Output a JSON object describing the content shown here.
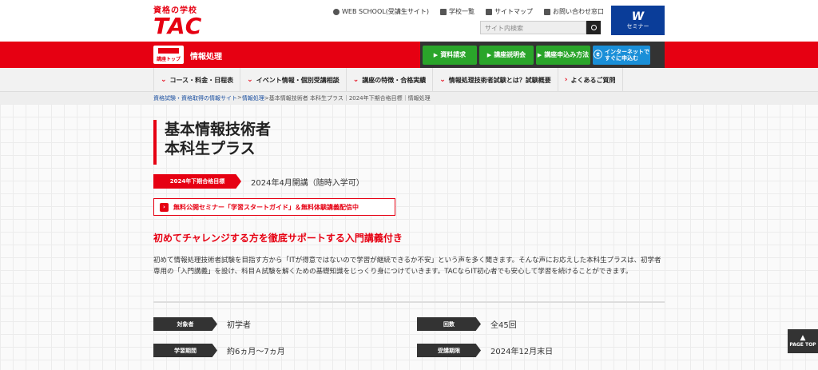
{
  "header": {
    "logo_top": "資格の学校",
    "logo_main": "TAC",
    "util_links": [
      "WEB SCHOOL(受講生サイト)",
      "学校一覧",
      "サイトマップ",
      "お問い合わせ窓口"
    ],
    "search_placeholder": "サイト内検索",
    "waseda_logo": "W",
    "waseda_text": "セミナー"
  },
  "redbar": {
    "course_top_label": "講座トップ",
    "title": "情報処理",
    "cta": [
      "資料請求",
      "講座説明会",
      "講座申込み方法"
    ],
    "internet_cta_line1": "インターネットで",
    "internet_cta_line2": "すぐに申込む"
  },
  "nav": {
    "items": [
      "コース・料金・日程表",
      "イベント情報・個別受講相談",
      "講座の特徴・合格実績",
      "情報処理技術者試験とは？試験概要",
      "よくあるご質問"
    ]
  },
  "breadcrumb": {
    "link1": "資格試験・資格取得の情報サイト",
    "sep": ">",
    "link2": "情報処理",
    "rest": ">基本情報技術者 本科生プラス｜2024年下期合格目標｜情報処理"
  },
  "main": {
    "title_line1": "基本情報技術者",
    "title_line2": "本科生プラス",
    "target_badge": "2024年下期合格目標",
    "start_date": "2024年4月開講（随時入学可）",
    "seminar_link": "無料公開セミナー「学習スタートガイド」＆無料体験講義配信中",
    "lead": "初めてチャレンジする方を徹底サポートする入門講義付き",
    "body": "初めて情報処理技術者試験を目指す方から「ITが得意ではないので学習が継続できるか不安」という声を多く聞きます。そんな声にお応えした本科生プラスは、初学者専用の「入門講義」を設け、科目Ａ試験を解くための基礎知識をじっくり身につけていきます。TACならIT初心者でも安心して学習を続けることができます。",
    "specs": [
      {
        "label": "対象者",
        "value": "初学者"
      },
      {
        "label": "回数",
        "value": "全45回"
      },
      {
        "label": "学習期間",
        "value": "約6ヵ月～7ヵ月"
      },
      {
        "label": "受講期限",
        "value": "2024年12月末日"
      }
    ]
  },
  "page_top": "PAGE TOP",
  "colors": {
    "brand_red": "#e60012",
    "cta_green": "#2aa52a",
    "cta_blue": "#1a8fd8"
  }
}
